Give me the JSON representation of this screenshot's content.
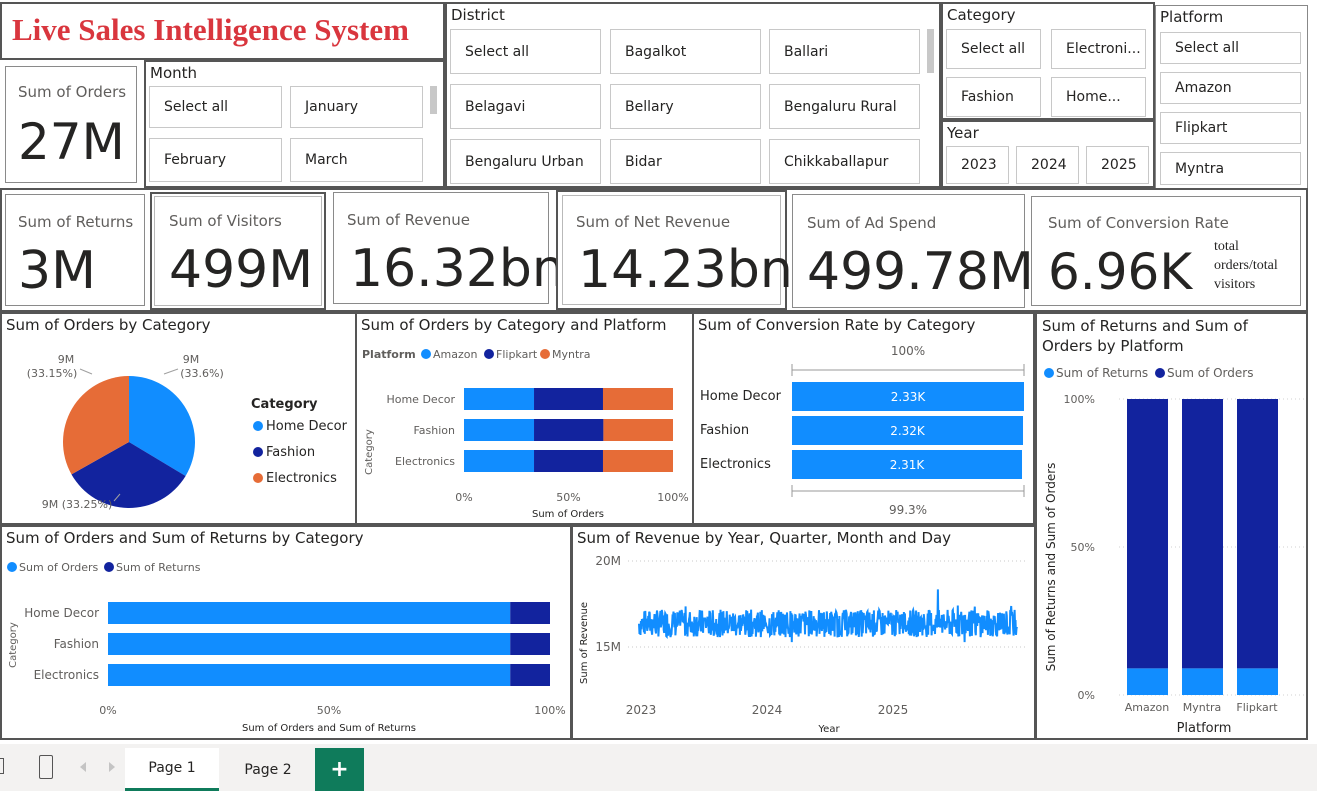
{
  "report_title": "Live Sales Intelligence System",
  "slicers": {
    "month": {
      "title": "Month",
      "options": [
        "Select all",
        "January",
        "February",
        "March"
      ]
    },
    "district": {
      "title": "District",
      "options": [
        "Select all",
        "Bagalkot",
        "Ballari",
        "Belagavi",
        "Bellary",
        "Bengaluru Rural",
        "Bengaluru Urban",
        "Bidar",
        "Chikkaballapur"
      ]
    },
    "category": {
      "title": "Category",
      "options": [
        "Select all",
        "Electroni...",
        "Fashion",
        "Home..."
      ]
    },
    "year": {
      "title": "Year",
      "options": [
        "2023",
        "2024",
        "2025"
      ]
    },
    "platform": {
      "title": "Platform",
      "options": [
        "Select all",
        "Amazon",
        "Flipkart",
        "Myntra"
      ]
    }
  },
  "kpis": {
    "orders": {
      "label": "Sum of Orders",
      "value": "27M"
    },
    "returns": {
      "label": "Sum of Returns",
      "value": "3M"
    },
    "visitors": {
      "label": "Sum of Visitors",
      "value": "499M"
    },
    "revenue": {
      "label": "Sum of Revenue",
      "value": "16.32bn"
    },
    "net_revenue": {
      "label": "Sum of Net Revenue",
      "value": "14.23bn"
    },
    "ad_spend": {
      "label": "Sum of Ad Spend",
      "value": "499.78M"
    },
    "conversion": {
      "label": "Sum of Conversion Rate",
      "value": "6.96K",
      "note_lines": [
        "total",
        "orders/total",
        "visitors"
      ]
    }
  },
  "colors": {
    "light_blue": "#118dff",
    "dark_blue": "#12239e",
    "orange": "#e66c37",
    "title_red": "#d9363e",
    "border": "#555555",
    "tab_green": "#0f7b5b"
  },
  "tabs": {
    "page1": "Page 1",
    "page2": "Page 2",
    "add": "+"
  },
  "icons": [
    "desktop-icon",
    "phone-icon",
    "chevron-left-icon",
    "chevron-right-icon",
    "plus-icon"
  ],
  "chart_data": [
    {
      "id": "pie",
      "type": "pie",
      "title": "Sum of Orders by Category",
      "legend_title": "Category",
      "legend_position": "right",
      "categories": [
        "Home Decor",
        "Fashion",
        "Electronics"
      ],
      "values_pct": [
        33.6,
        33.25,
        33.15
      ],
      "data_labels": [
        "9M\n(33.6%)",
        "9M (33.25%)",
        "9M\n(33.15%)"
      ],
      "colors": [
        "#118dff",
        "#12239e",
        "#e66c37"
      ]
    },
    {
      "id": "stacked_platform",
      "type": "bar",
      "stacking": "100%",
      "title": "Sum of Orders by Category and Platform",
      "legend_title": "Platform",
      "legend_position": "top-left",
      "categories": [
        "Home Decor",
        "Fashion",
        "Electronics"
      ],
      "series": [
        {
          "name": "Amazon",
          "values": [
            33.5,
            33.5,
            33.5
          ],
          "color": "#118dff"
        },
        {
          "name": "Flipkart",
          "values": [
            33.0,
            33.2,
            33.0
          ],
          "color": "#12239e"
        },
        {
          "name": "Myntra",
          "values": [
            33.5,
            33.3,
            33.5
          ],
          "color": "#e66c37"
        }
      ],
      "x_ticks": [
        "0%",
        "50%",
        "100%"
      ],
      "xlabel": "Sum of Orders",
      "ylabel": "Category"
    },
    {
      "id": "conversion",
      "type": "bar",
      "title": "Sum of Conversion Rate by Category",
      "categories": [
        "Home Decor",
        "Fashion",
        "Electronics"
      ],
      "values": [
        2330,
        2320,
        2310
      ],
      "value_labels": [
        "2.33K",
        "2.32K",
        "2.31K"
      ],
      "top_label": "100%",
      "bottom_label": "99.3%",
      "color": "#118dff"
    },
    {
      "id": "returns_platform",
      "type": "bar",
      "orientation": "vertical",
      "stacking": "100%",
      "title_lines": [
        "Sum of Returns and Sum of",
        "Orders by Platform"
      ],
      "legend_position": "top-left",
      "categories": [
        "Amazon",
        "Myntra",
        "Flipkart"
      ],
      "series": [
        {
          "name": "Sum of Returns",
          "values": [
            9,
            9,
            9
          ],
          "color": "#118dff"
        },
        {
          "name": "Sum of Orders",
          "values": [
            91,
            91,
            91
          ],
          "color": "#12239e"
        }
      ],
      "y_ticks": [
        "0%",
        "50%",
        "100%"
      ],
      "xlabel": "Platform",
      "ylabel": "Sum of Returns and Sum of Orders"
    },
    {
      "id": "orders_returns",
      "type": "bar",
      "stacking": "100%",
      "title": "Sum of Orders and Sum of Returns by Category",
      "legend_position": "top-left",
      "categories": [
        "Home Decor",
        "Fashion",
        "Electronics"
      ],
      "series": [
        {
          "name": "Sum of Orders",
          "values": [
            91,
            91,
            91
          ],
          "color": "#118dff"
        },
        {
          "name": "Sum of Returns",
          "values": [
            9,
            9,
            9
          ],
          "color": "#12239e"
        }
      ],
      "x_ticks": [
        "0%",
        "50%",
        "100%"
      ],
      "xlabel": "Sum of Orders and Sum of Returns",
      "ylabel": "Category"
    },
    {
      "id": "revenue_line",
      "type": "line",
      "title": "Sum of Revenue by Year, Quarter, Month and Day",
      "x_range": [
        "2023-01-01",
        "2025-12-31"
      ],
      "x_ticks": [
        "2023",
        "2024",
        "2025"
      ],
      "y_ticks": [
        "20M",
        "15M"
      ],
      "ylim": [
        13500000,
        20500000
      ],
      "approx_mean": 15500000,
      "approx_range": [
        14000000,
        18600000
      ],
      "xlabel": "Year",
      "ylabel": "Sum of Revenue",
      "color": "#118dff"
    }
  ]
}
